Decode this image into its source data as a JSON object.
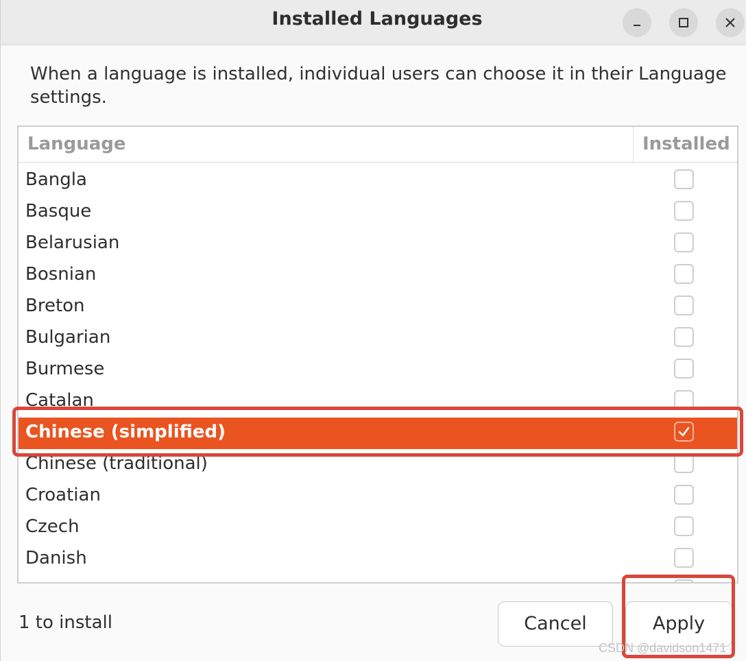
{
  "window": {
    "title": "Installed Languages",
    "controls": {
      "minimize": "–",
      "maximize": "□",
      "close": "×"
    }
  },
  "description": "When a language is installed, individual users can choose it in their Language settings.",
  "list": {
    "columns": {
      "language": "Language",
      "installed": "Installed"
    },
    "rows": [
      {
        "language": "Bangla",
        "installed": false
      },
      {
        "language": "Basque",
        "installed": false
      },
      {
        "language": "Belarusian",
        "installed": false
      },
      {
        "language": "Bosnian",
        "installed": false
      },
      {
        "language": "Breton",
        "installed": false
      },
      {
        "language": "Bulgarian",
        "installed": false
      },
      {
        "language": "Burmese",
        "installed": false
      },
      {
        "language": "Catalan",
        "installed": false
      },
      {
        "language": "Chinese (simplified)",
        "installed": true,
        "selected": true
      },
      {
        "language": "Chinese (traditional)",
        "installed": false
      },
      {
        "language": "Croatian",
        "installed": false
      },
      {
        "language": "Czech",
        "installed": false
      },
      {
        "language": "Danish",
        "installed": false
      },
      {
        "language": "",
        "installed": false
      }
    ]
  },
  "footer": {
    "status": "1 to install",
    "cancel_label": "Cancel",
    "apply_label": "Apply"
  },
  "watermark": "CSDN @davidson1471",
  "colors": {
    "accent": "#e95420",
    "annotation": "#d9463a"
  }
}
